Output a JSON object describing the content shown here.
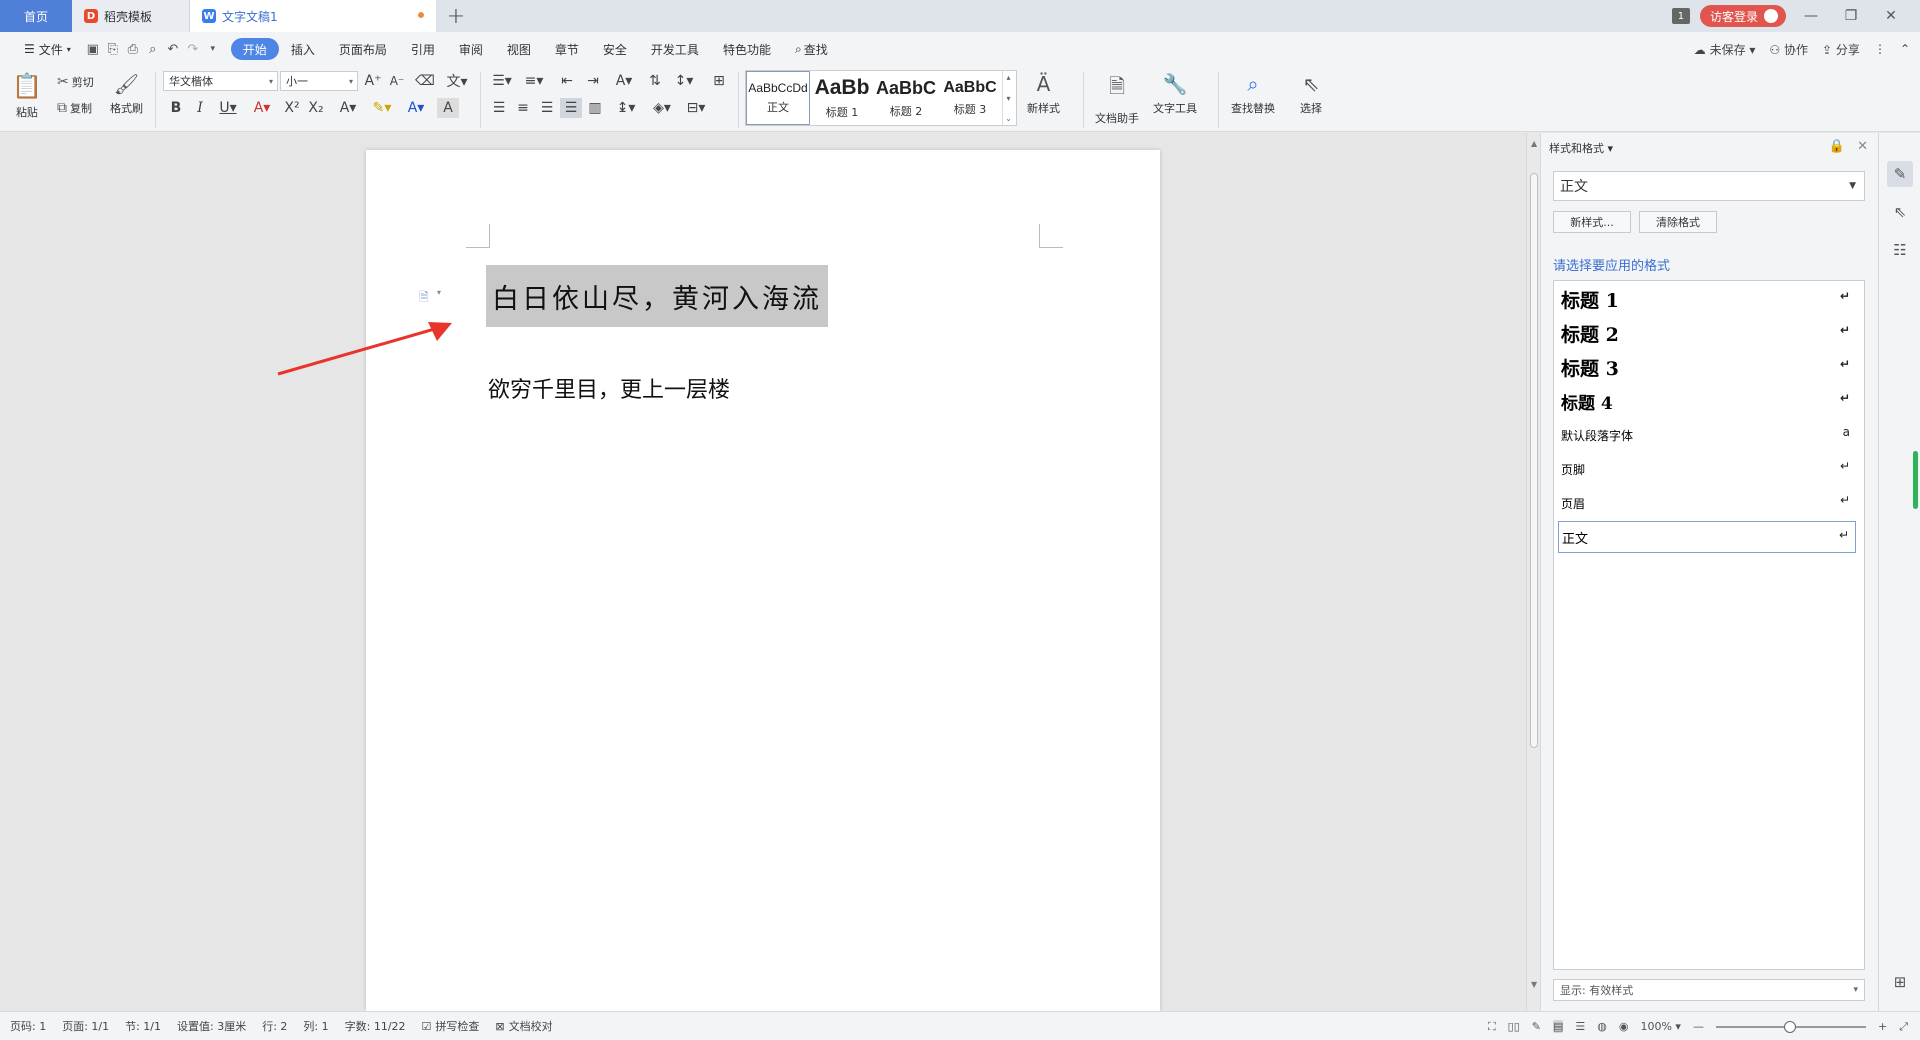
{
  "tabs": {
    "home": "首页",
    "daoke": "稻壳模板",
    "doc": "文字文稿1",
    "add": "+"
  },
  "titlebar": {
    "badge": "1",
    "login": "访客登录"
  },
  "menu": {
    "file": "文件",
    "items": [
      "开始",
      "插入",
      "页面布局",
      "引用",
      "审阅",
      "视图",
      "章节",
      "安全",
      "开发工具",
      "特色功能"
    ],
    "search": "查找",
    "unsaved": "未保存",
    "collab": "协作",
    "share": "分享"
  },
  "ribbon": {
    "paste": "粘贴",
    "cut": "剪切",
    "copy": "复制",
    "format_painter": "格式刷",
    "font_name": "华文楷体",
    "font_size": "小一",
    "styles": [
      {
        "sample": "AaBbCcDd",
        "name": "正文"
      },
      {
        "sample": "AaBb",
        "name": "标题 1"
      },
      {
        "sample": "AaBbC",
        "name": "标题 2"
      },
      {
        "sample": "AaBbC",
        "name": "标题 3"
      }
    ],
    "new_style": "新样式",
    "doc_helper": "文档助手",
    "text_tools": "文字工具",
    "find_replace": "查找替换",
    "select": "选择"
  },
  "document": {
    "line1": "白日依山尽，黄河入海流",
    "line2": "欲穷千里目，更上一层楼"
  },
  "style_panel": {
    "title": "样式和格式",
    "current": "正文",
    "new_style_btn": "新样式...",
    "clear_btn": "清除格式",
    "hint": "请选择要应用的格式",
    "items": [
      {
        "label": "标题 1",
        "mark": "↵"
      },
      {
        "label": "标题 2",
        "mark": "↵"
      },
      {
        "label": "标题 3",
        "mark": "↵"
      },
      {
        "label": "标题 4",
        "mark": "↵"
      },
      {
        "label": "默认段落字体",
        "mark": "a"
      },
      {
        "label": "页脚",
        "mark": "↵"
      },
      {
        "label": "页眉",
        "mark": "↵"
      },
      {
        "label": "正文",
        "mark": "↵"
      }
    ],
    "show": "显示: 有效样式"
  },
  "status": {
    "page_no": "页码: 1",
    "pages": "页面: 1/1",
    "section": "节: 1/1",
    "setting": "设置值: 3厘米",
    "row": "行: 2",
    "col": "列: 1",
    "words": "字数: 11/22",
    "spell": "拼写检查",
    "proof": "文档校对",
    "zoom": "100%"
  }
}
